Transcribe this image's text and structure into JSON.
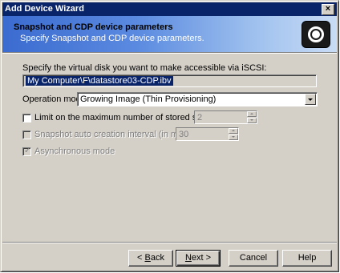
{
  "window": {
    "title": "Add Device Wizard",
    "close_glyph": "×"
  },
  "header": {
    "title": "Snapshot and CDP device parameters",
    "subtitle": "Specify Snapshot and CDP device parameters.",
    "icon": "disk-target-icon"
  },
  "form": {
    "disk_label": "Specify the virtual disk you want to make accessible via iSCSI:",
    "disk_path": "My Computer\\F\\datastore03-CDP.ibv",
    "operation_mode_label": "Operation mode:",
    "operation_mode_value": "Growing Image (Thin Provisioning)",
    "limit_snapshots_label": "Limit on the maximum number of stored snapshots:",
    "limit_snapshots_value": "2",
    "limit_snapshots_checked": false,
    "auto_interval_label": "Snapshot auto creation interval (in minutes):",
    "auto_interval_value": "30",
    "auto_interval_checked": false,
    "async_label": "Asynchronous mode",
    "async_checked": true
  },
  "buttons": {
    "back_prefix": "< ",
    "back_u": "B",
    "back_rest": "ack",
    "next_u": "N",
    "next_rest": "ext >",
    "cancel": "Cancel",
    "help": "Help"
  },
  "colors": {
    "title_bar": "#0a246a",
    "face": "#d4d0c8",
    "header_gradient_start": "#3b6bcf",
    "header_gradient_end": "#c9dcf5",
    "selection": "#0a246a"
  }
}
